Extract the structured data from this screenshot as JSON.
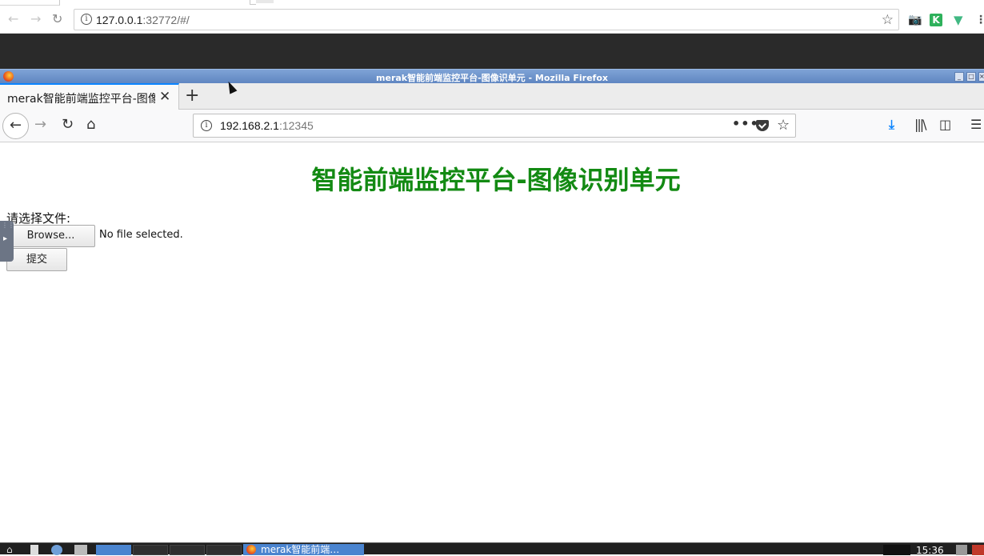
{
  "outer_browser": {
    "url_host": "127.0.0.1",
    "url_rest": ":32772/#/",
    "icons": [
      "back-icon",
      "forward-icon",
      "reload-icon",
      "info-icon",
      "star-icon",
      "camera-icon",
      "extension-k-icon",
      "extension-vue-icon",
      "menu-icon"
    ]
  },
  "firefox": {
    "window_title": "merak智能前端监控平台-图像识单元 - Mozilla Firefox",
    "tab_label": "merak智能前端监控平台-图像识别单元",
    "url_host": "192.168.2.1",
    "url_port": ":12345"
  },
  "page": {
    "title": "智能前端监控平台-图像识别单元",
    "file_label": "请选择文件:",
    "browse_label": "Browse...",
    "file_status": "No file selected.",
    "submit_label": "提交"
  },
  "taskbar": {
    "active_task": "merak智能前端…",
    "clock": "15:36"
  },
  "colors": {
    "title_green": "#138a13",
    "titlebar_blue": "#6d93cb",
    "task_blue": "#4a84cf"
  }
}
